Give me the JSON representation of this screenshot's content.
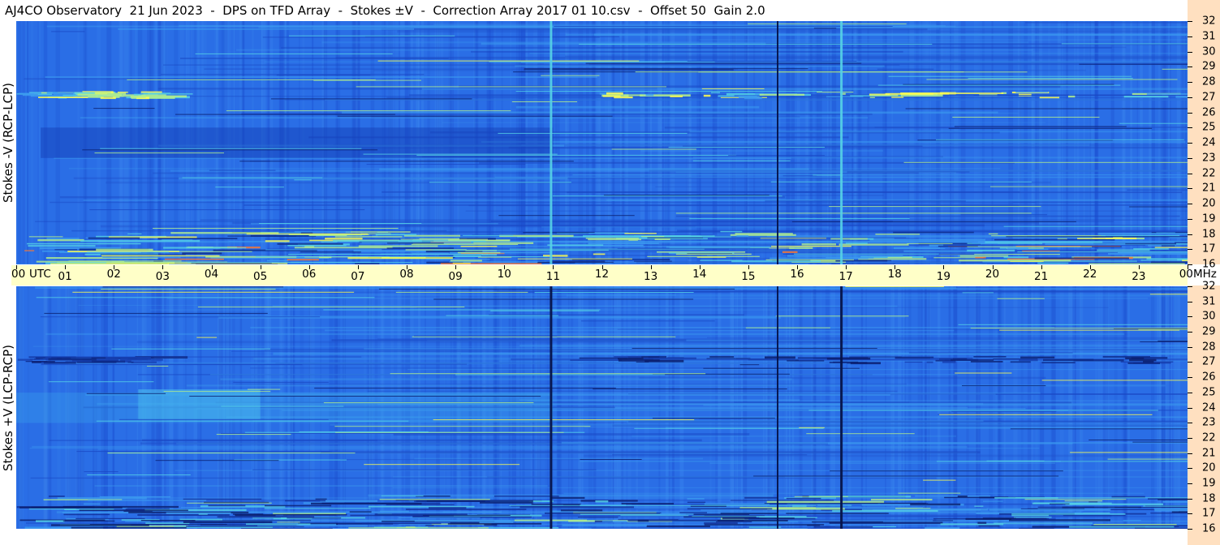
{
  "title": "AJ4CO Observatory  21 Jun 2023  -  DPS on TFD Array  -  Stokes ±V  -  Correction Array 2017 01 10.csv  -  Offset 50  Gain 2.0",
  "chart_data": [
    {
      "type": "heatmap",
      "ylabel": "Stokes -V (RCP-LCP)",
      "x_ticks": [
        "00",
        "01",
        "02",
        "03",
        "04",
        "05",
        "06",
        "07",
        "08",
        "09",
        "10",
        "11",
        "12",
        "13",
        "14",
        "15",
        "16",
        "17",
        "18",
        "19",
        "20",
        "21",
        "22",
        "23",
        "00"
      ],
      "x_unit_label": "UTC",
      "y_unit_label": "MHz",
      "y_ticks": [
        "16",
        "17",
        "18",
        "19",
        "20",
        "21",
        "22",
        "23",
        "24",
        "25",
        "26",
        "27",
        "28",
        "29",
        "30",
        "31",
        "32"
      ],
      "xlim": [
        0,
        24
      ],
      "ylim": [
        16,
        32
      ],
      "colormap": [
        "#0a1e6e",
        "#1e4fd8",
        "#2a6ee6",
        "#3c9bf0",
        "#55d2e6",
        "#b4f08c",
        "#ffff50",
        "#ff7830"
      ],
      "base_color": "#2a6ee6",
      "features": {
        "bright_vertical_lines_utc": [
          10.95,
          16.9
        ],
        "dark_vertical_lines_utc": [
          15.6
        ],
        "dark_band_utc": [
          0.5,
          11.0
        ],
        "dark_band_mhz": [
          23.0,
          25.0
        ],
        "bright_band_mhz": [
          27.0,
          27.4
        ],
        "noisy_band_mhz": [
          16.0,
          18.2
        ]
      }
    },
    {
      "type": "heatmap",
      "ylabel": "Stokes +V (LCP-RCP)",
      "y_ticks": [
        "16",
        "17",
        "18",
        "19",
        "20",
        "21",
        "22",
        "23",
        "24",
        "25",
        "26",
        "27",
        "28",
        "29",
        "30",
        "31",
        "32"
      ],
      "xlim": [
        0,
        24
      ],
      "ylim": [
        16,
        32
      ],
      "base_color": "#2a6ee6",
      "features": {
        "dark_vertical_lines_utc": [
          10.95,
          16.9,
          15.6
        ],
        "bright_band_utc": [
          2.5,
          5.0
        ],
        "bright_band_mhz": [
          23.2,
          25.2
        ],
        "dark_band_mhz": [
          27.0,
          27.4
        ],
        "noisy_band_mhz": [
          16.0,
          18.2
        ]
      }
    }
  ]
}
